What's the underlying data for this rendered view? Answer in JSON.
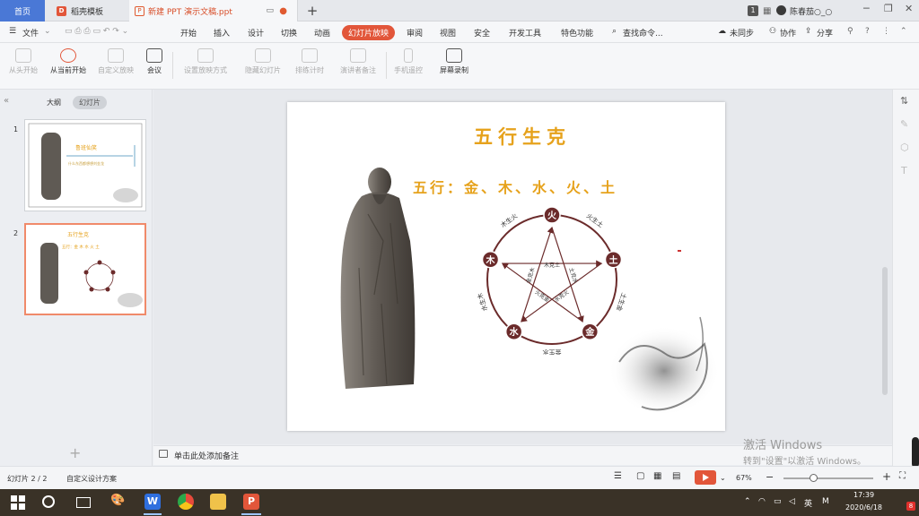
{
  "tabs": {
    "home": "首页",
    "template": "稻壳模板",
    "document": "新建 PPT 演示文稿.ppt",
    "add": "+",
    "badge": "1",
    "user": "陈春茄○_○"
  },
  "menu": {
    "file": "文件",
    "items": [
      "开始",
      "插入",
      "设计",
      "切换",
      "动画",
      "幻灯片放映",
      "审阅",
      "视图",
      "安全",
      "开发工具",
      "特色功能"
    ],
    "search": "查找命令...",
    "sync": "未同步",
    "collab": "协作",
    "share": "分享"
  },
  "toolbar": {
    "buttons": [
      {
        "label": "从头开始",
        "enabled": false
      },
      {
        "label": "从当前开始",
        "enabled": true
      },
      {
        "label": "自定义放映",
        "enabled": false
      },
      {
        "label": "会议",
        "enabled": true
      },
      {
        "label": "设置放映方式",
        "enabled": false
      },
      {
        "label": "隐藏幻灯片",
        "enabled": false
      },
      {
        "label": "排练计时",
        "enabled": false
      },
      {
        "label": "演讲者备注",
        "enabled": false
      },
      {
        "label": "手机遥控",
        "enabled": false
      },
      {
        "label": "屏幕录制",
        "enabled": true
      }
    ]
  },
  "panel": {
    "outline": "大纲",
    "slides": "幻灯片",
    "numbers": [
      "1",
      "2"
    ],
    "add": "+"
  },
  "slide": {
    "title": "五行生克",
    "subtitle": "五行：金、木、水、火、土",
    "elements": [
      "火",
      "土",
      "金",
      "水",
      "木"
    ],
    "generating": [
      "火生土",
      "土生金",
      "金生水",
      "水生木",
      "木生火"
    ],
    "overcoming": [
      "木克土",
      "土克水",
      "水克火",
      "火克金",
      "金克木"
    ]
  },
  "thumb1": {
    "title": "鲁班仙笑",
    "sub": "什么东西都想想刘金龙"
  },
  "thumb2": {
    "title": "五行生克",
    "sub": "五行：金 木 水 火 土"
  },
  "notes": {
    "placeholder": "单击此处添加备注"
  },
  "status": {
    "slide": "幻灯片 2 / 2",
    "design": "自定义设计方案",
    "zoom": "67%"
  },
  "watermark": {
    "line1": "激活 Windows",
    "line2": "转到\"设置\"以激活 Windows。"
  },
  "taskbar": {
    "time": "17:39",
    "date": "2020/6/18",
    "lang": "英",
    "ime": "M"
  },
  "colors": {
    "accent": "#e2563a",
    "title_gold": "#e6a21c",
    "element_circle": "#6b2b2b",
    "taskbar": "#3a3227"
  }
}
